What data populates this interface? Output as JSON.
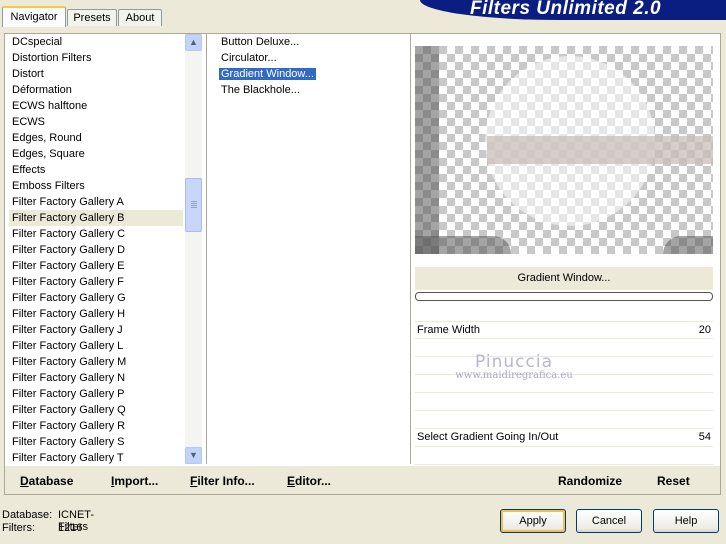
{
  "tabs": [
    "Navigator",
    "Presets",
    "About"
  ],
  "banner_title": "Filters Unlimited 2.0",
  "categories": [
    "DCspecial",
    "Distortion Filters",
    "Distort",
    "Déformation",
    "ECWS halftone",
    "ECWS",
    "Edges, Round",
    "Edges, Square",
    "Effects",
    "Emboss Filters",
    "Filter Factory Gallery A",
    "Filter Factory Gallery B",
    "Filter Factory Gallery C",
    "Filter Factory Gallery D",
    "Filter Factory Gallery E",
    "Filter Factory Gallery F",
    "Filter Factory Gallery G",
    "Filter Factory Gallery H",
    "Filter Factory Gallery J",
    "Filter Factory Gallery L",
    "Filter Factory Gallery M",
    "Filter Factory Gallery N",
    "Filter Factory Gallery P",
    "Filter Factory Gallery Q",
    "Filter Factory Gallery R",
    "Filter Factory Gallery S",
    "Filter Factory Gallery T"
  ],
  "selected_category": "Filter Factory Gallery B",
  "filters": [
    "Button Deluxe...",
    "Circulator...",
    "Gradient Window...",
    "The Blackhole..."
  ],
  "selected_filter": "Gradient Window...",
  "filter_name": "Gradient Window...",
  "params": [
    {
      "name": "Frame Width",
      "value": "20"
    },
    {
      "name": "",
      "value": ""
    },
    {
      "name": "",
      "value": ""
    },
    {
      "name": "",
      "value": ""
    },
    {
      "name": "",
      "value": ""
    },
    {
      "name": "",
      "value": ""
    },
    {
      "name": "Select Gradient Going In/Out",
      "value": "54"
    },
    {
      "name": "",
      "value": ""
    }
  ],
  "watermark": {
    "line1": "Pinuccia",
    "line2": "www.maidiregrafica.eu"
  },
  "actions": {
    "database": "Database",
    "import": "Import...",
    "filter_info": "Filter Info...",
    "editor": "Editor...",
    "randomize": "Randomize",
    "reset": "Reset"
  },
  "footer": {
    "database_label": "Database:",
    "database_value": "ICNET-Filters",
    "filters_label": "Filters:",
    "filters_value": "1216"
  },
  "buttons": {
    "apply": "Apply",
    "cancel": "Cancel",
    "help": "Help"
  },
  "icons": {
    "scroll_up": "chevron-up-icon",
    "scroll_down": "chevron-down-icon"
  },
  "colors": {
    "banner": "#0A1E82",
    "selection": "#316AC5",
    "dialog": "#ECE9D8"
  }
}
